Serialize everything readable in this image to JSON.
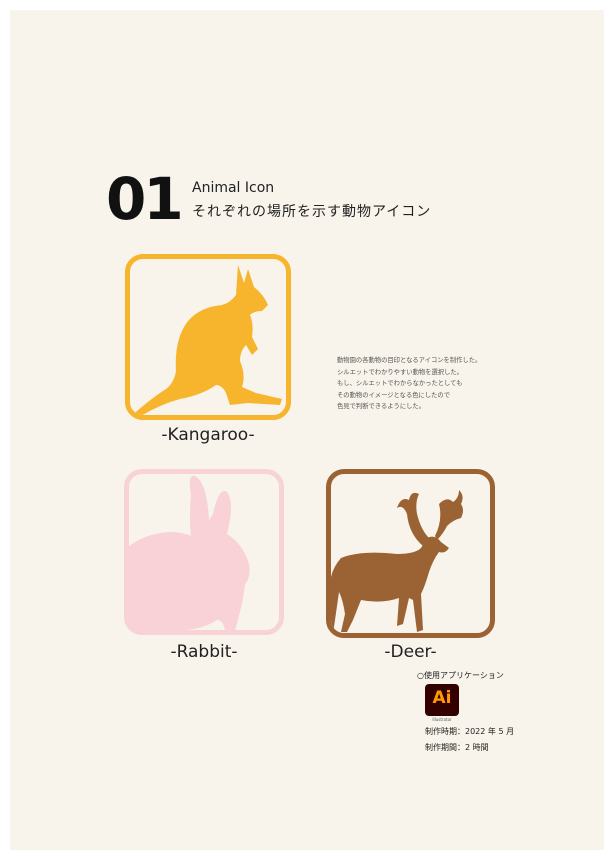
{
  "header": {
    "number": "01",
    "title_en": "Animal Icon",
    "title_jp": "それぞれの場所を示す動物アイコン"
  },
  "icons": [
    {
      "name": "kangaroo",
      "label": "-Kangaroo-",
      "color": "#f6b52c"
    },
    {
      "name": "rabbit",
      "label": "-Rabbit-",
      "color": "#f8d2d6"
    },
    {
      "name": "deer",
      "label": "-Deer-",
      "color": "#9b6233"
    }
  ],
  "description": [
    "動物園の各動物の目印となるアイコンを制作した。",
    "シルエットでわかりやすい動物を選択した。",
    "もし、シルエットでわからなかったとしても",
    "その動物のイメージとなる色にしたので",
    "色見で判断できるようにした。"
  ],
  "apps": {
    "heading": "○使用アプリケーション",
    "icon": "adobe-illustrator-icon",
    "badge_text": "Ai",
    "badge_caption": "Illustrator",
    "badge_bg": "#330000",
    "badge_fg": "#ff9a00"
  },
  "meta": {
    "date": "制作時期：2022 年 5 月",
    "duration": "制作期間：2 時間"
  }
}
